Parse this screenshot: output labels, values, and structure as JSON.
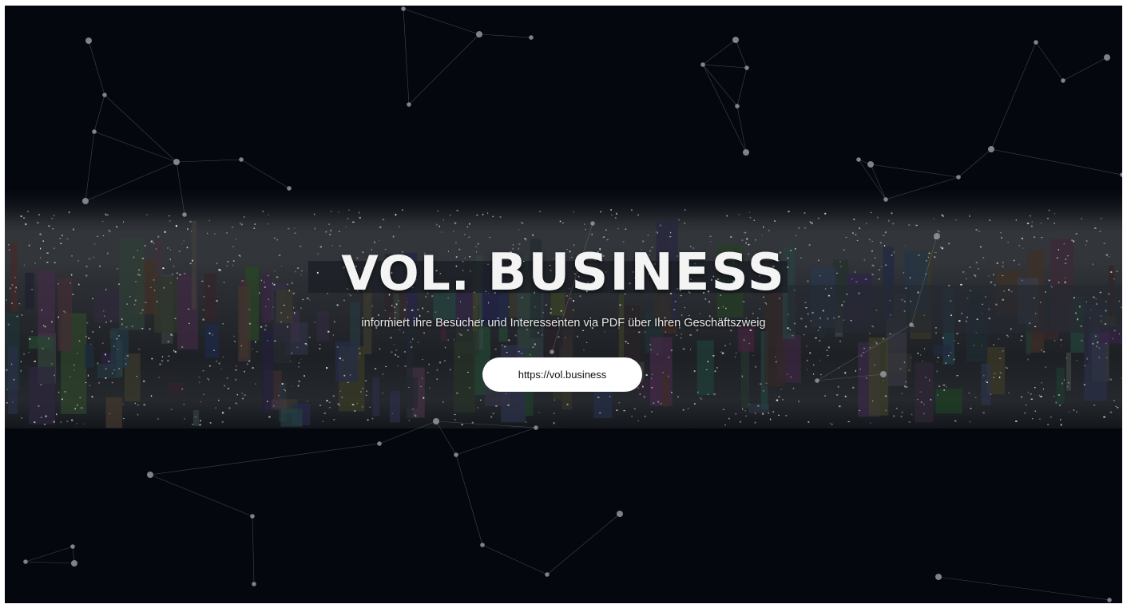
{
  "hero": {
    "title_part1": "VOL.",
    "title_part2": "BUSINESS",
    "subtitle": "informiert ihre Besucher und Interessenten via PDF über Ihren Geschäftszweig",
    "cta_label": "https://vol.business"
  },
  "colors": {
    "background": "#04070d",
    "text": "#f4f4f4",
    "button_bg": "#ffffff",
    "button_text": "#111111",
    "network": "#8a8f96"
  },
  "background_image": {
    "subject": "city-skyline-at-night",
    "icon": "network-constellation"
  }
}
